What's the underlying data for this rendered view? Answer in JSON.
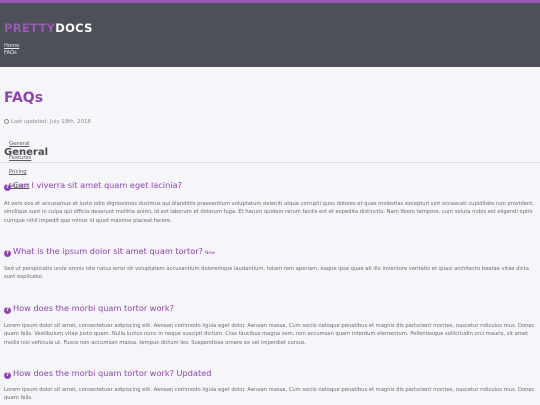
{
  "header": {
    "logo_part1": "PRETTY",
    "logo_part2": "DOCS",
    "breadcrumb": {
      "home": "Home",
      "current": "FAQs"
    }
  },
  "main": {
    "title": "FAQs",
    "last_updated": "Last updated: July 18th, 2018",
    "section_title": "General",
    "nav_links": [
      "General",
      "Features",
      "Pricing",
      "Support"
    ]
  },
  "faqs": [
    {
      "question": "Can I viverra sit amet quam eget lacinia?",
      "badge": "",
      "answer": "At vero eos et accusamus et iusto odio dignissimos ducimus qui blanditiis praesentium voluptatum deleniti atque corrupti quos dolores et quas molestias excepturi sint occaecati cupiditate non provident, similique sunt in culpa qui officia deserunt mollitia animi, id est laborum et dolorum fuga. Et harum quidem rerum facilis est et expedita distinctio. Nam libero tempore, cum soluta nobis est eligendi optio cumque nihil impedit quo minus id quod maxime placeat facere."
    },
    {
      "question": "What is the ipsum dolor sit amet quam tortor?",
      "badge": "New",
      "answer": "Sed ut perspiciatis unde omnis iste natus error sit voluptatem accusantium doloremque laudantium, totam rem aperiam, eaque ipsa quae ab illo inventore veritatis et quasi architecto beatae vitae dicta sunt explicabo."
    },
    {
      "question": "How does the morbi quam tortor work?",
      "badge": "",
      "answer": "Lorem ipsum dolor sit amet, consectetuer adipiscing elit. Aenean commodo ligula eget dolor. Aenean massa. Cum sociis natoque penatibus et magnis dis parturient montes, nascetur ridiculus mus. Donec quam felis. Vestibulum vitae justo quam. Nulla luctus nunc in neque suscipit dictum. Cras faucibus magna sem, non accumsan quam interdum elementum. Pellentesque sollicitudin orci mauris, sit amet mollis nisi vehicula ut. Fusce non accumsan massa, tempus dictum leo. Suspendisse ornare ex vel imperdiet cursus."
    },
    {
      "question": "How does the morbi quam tortor work? Updated",
      "badge": "",
      "answer": "Lorem ipsum dolor sit amet, consectetuer adipiscing elit. Aenean commodo ligula eget dolor. Aenean massa. Cum sociis natoque penatibus et magnis dis parturient montes, nascetur ridiculus mus. Donec quam felis."
    }
  ],
  "colors": {
    "accent": "#8e44ad",
    "header_bg": "#4d4f59",
    "page_bg": "#f6f5fa"
  },
  "icons": {
    "faq": "question-circle-icon",
    "updated": "clock-icon"
  }
}
